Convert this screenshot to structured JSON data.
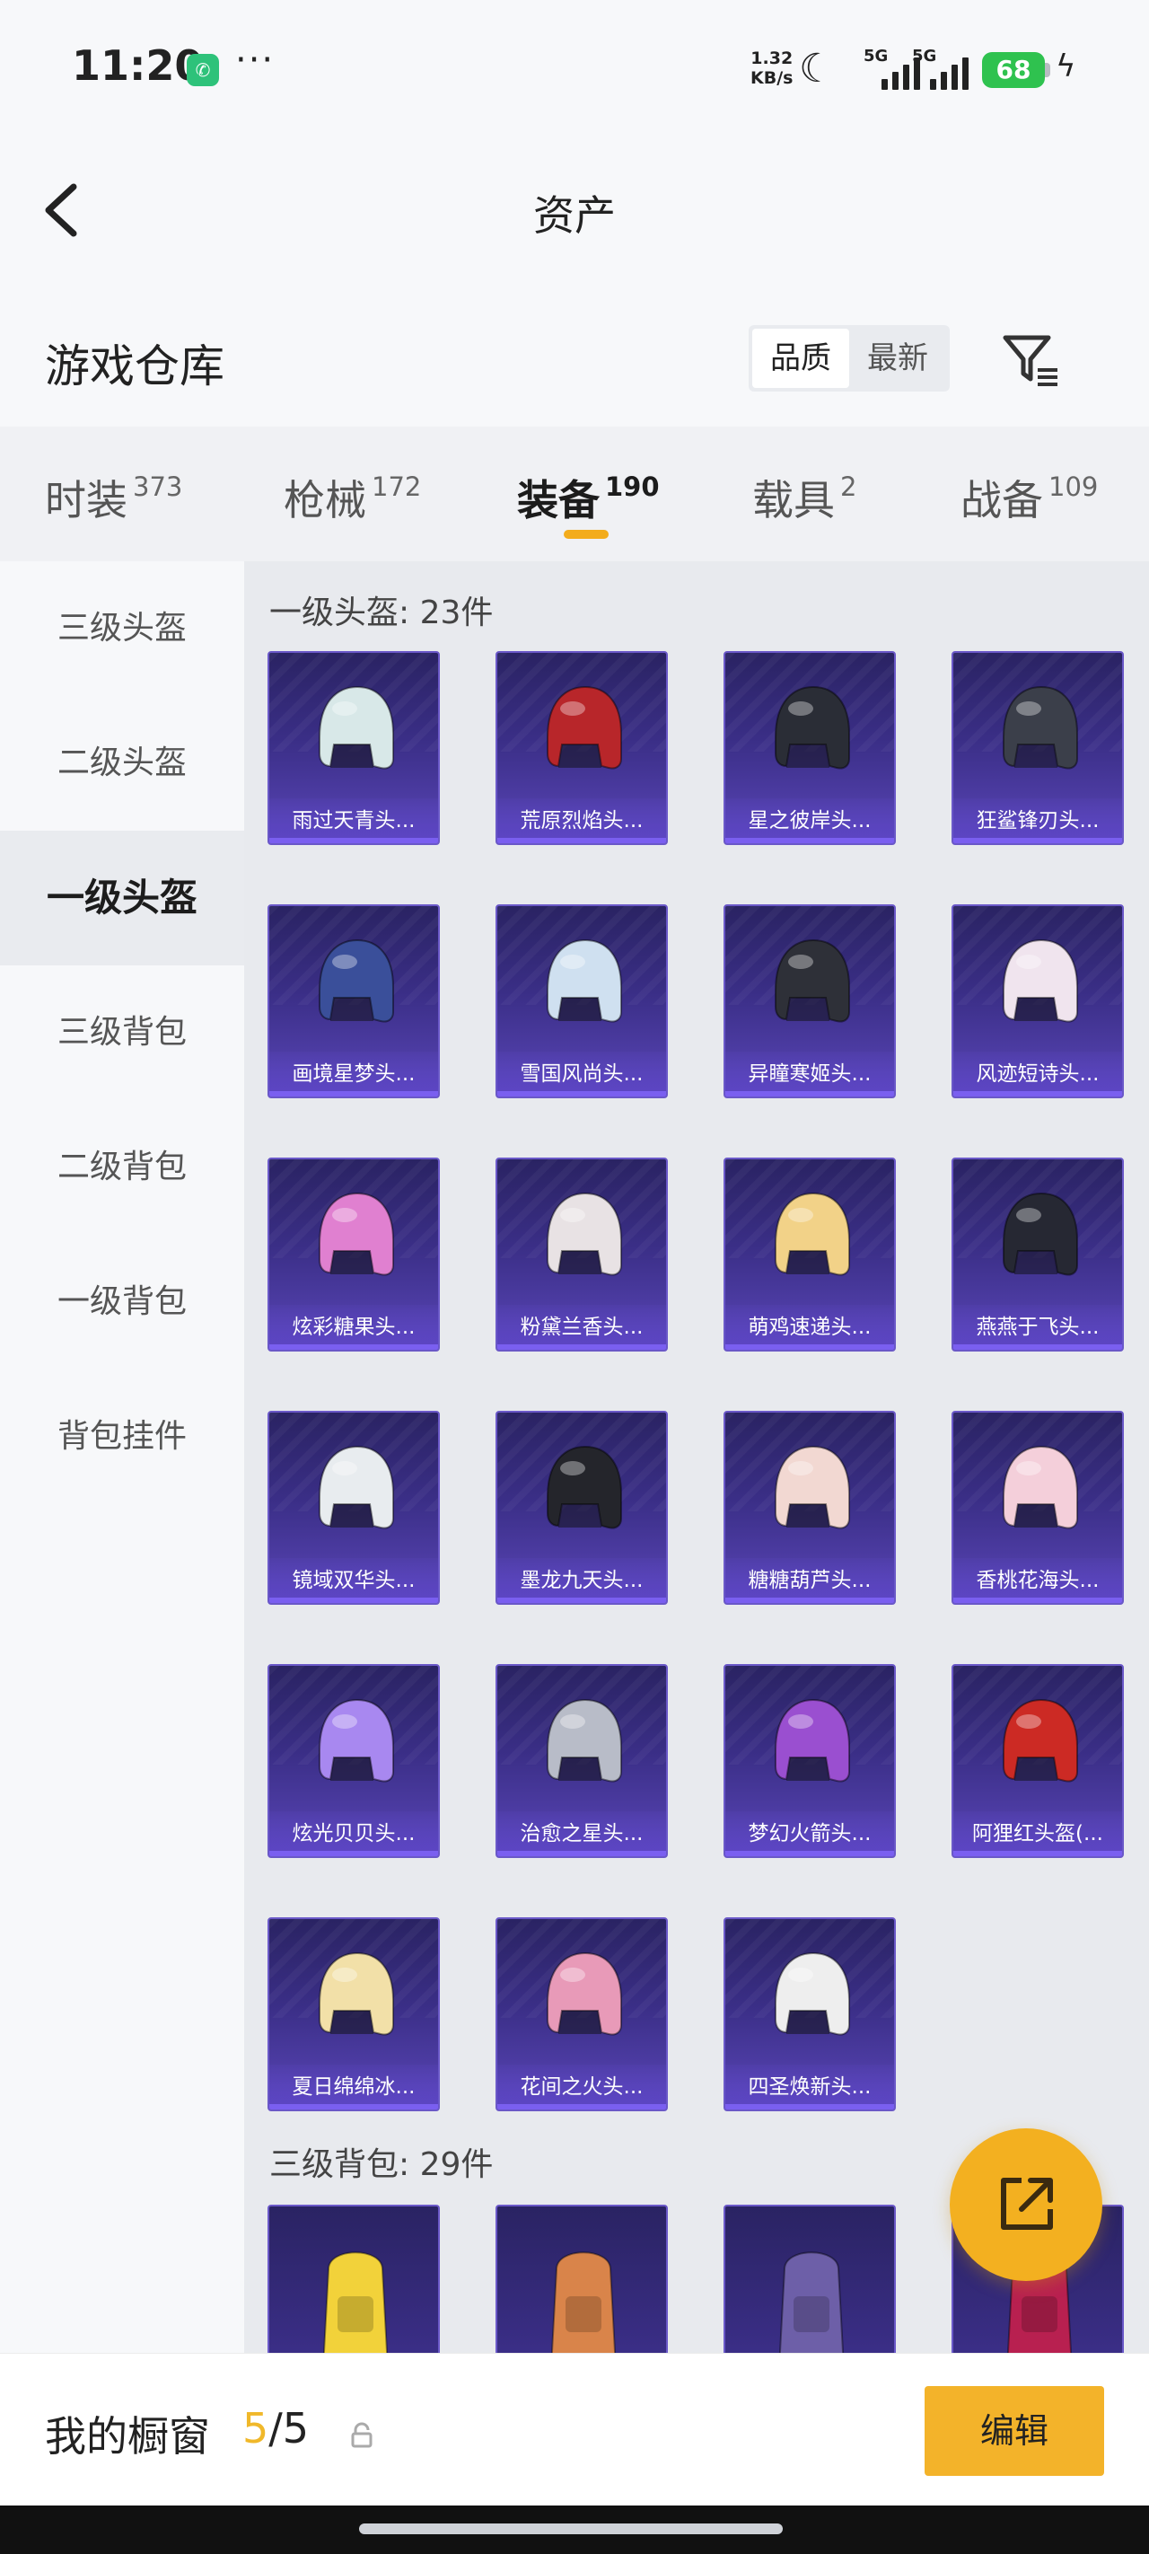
{
  "status_bar": {
    "time": "11:20",
    "net_speed_value": "1.32",
    "net_speed_unit": "KB/s",
    "signal_1": "5G",
    "signal_2": "5G",
    "battery": "68",
    "more": "···",
    "icons": [
      "wechat-icon",
      "moon-icon",
      "signal-icon",
      "battery-icon",
      "charging-icon"
    ]
  },
  "nav": {
    "title": "资产"
  },
  "warehouse": {
    "title": "游戏仓库",
    "sort_options": [
      "品质",
      "最新"
    ],
    "active_sort": "品质"
  },
  "categories": [
    {
      "label": "时装",
      "count": "373"
    },
    {
      "label": "枪械",
      "count": "172"
    },
    {
      "label": "装备",
      "count": "190"
    },
    {
      "label": "载具",
      "count": "2"
    },
    {
      "label": "战备",
      "count": "109"
    }
  ],
  "active_category": "装备",
  "sidebar": {
    "items": [
      "三级头盔",
      "二级头盔",
      "一级头盔",
      "三级背包",
      "二级背包",
      "一级背包",
      "背包挂件"
    ],
    "active": "一级头盔"
  },
  "sections": [
    {
      "title": "一级头盔: 23件",
      "items": [
        {
          "name": "雨过天青头...",
          "color": "#d8e8e8"
        },
        {
          "name": "荒原烈焰头...",
          "color": "#b8262a"
        },
        {
          "name": "星之彼岸头...",
          "color": "#2a2d36"
        },
        {
          "name": "狂鲨锋刃头...",
          "color": "#3b3f4a"
        },
        {
          "name": "画境星梦头...",
          "color": "#3a4f9a"
        },
        {
          "name": "雪国风尚头...",
          "color": "#cfe0f0"
        },
        {
          "name": "异瞳寒姬头...",
          "color": "#2e3038"
        },
        {
          "name": "风迹短诗头...",
          "color": "#f0e4ee"
        },
        {
          "name": "炫彩糖果头...",
          "color": "#e080d0"
        },
        {
          "name": "粉黛兰香头...",
          "color": "#e8e2e4"
        },
        {
          "name": "萌鸡速递头...",
          "color": "#f2d288"
        },
        {
          "name": "燕燕于飞头...",
          "color": "#262833"
        },
        {
          "name": "镜域双华头...",
          "color": "#e8ecef"
        },
        {
          "name": "墨龙九天头...",
          "color": "#24252b"
        },
        {
          "name": "糖糖葫芦头...",
          "color": "#f2d8d2"
        },
        {
          "name": "香桃花海头...",
          "color": "#f4cfda"
        },
        {
          "name": "炫光贝贝头...",
          "color": "#a888f0"
        },
        {
          "name": "治愈之星头...",
          "color": "#b8bcc8"
        },
        {
          "name": "梦幻火箭头...",
          "color": "#9a4fd0"
        },
        {
          "name": "阿狸红头盔(...",
          "color": "#cc2a24"
        },
        {
          "name": "夏日绵绵冰...",
          "color": "#f2e0a8"
        },
        {
          "name": "花间之火头...",
          "color": "#e89ab8"
        },
        {
          "name": "四圣焕新头...",
          "color": "#eeeeee"
        }
      ]
    },
    {
      "title": "三级背包: 29件",
      "items": [
        {
          "name": "",
          "color": "#f2d23a"
        },
        {
          "name": "",
          "color": "#d9844a"
        },
        {
          "name": "",
          "color": "#6d5fa8"
        },
        {
          "name": "",
          "color": "#b82050"
        }
      ]
    }
  ],
  "bottom": {
    "title": "我的橱窗",
    "current": "5",
    "separator": "/",
    "total": "5",
    "edit_label": "编辑"
  }
}
